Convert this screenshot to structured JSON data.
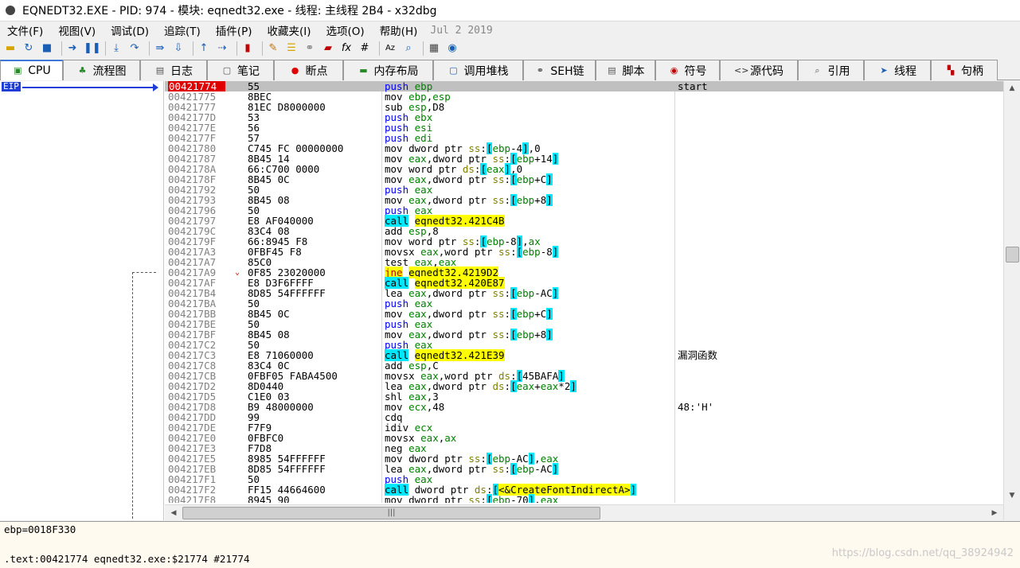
{
  "window": {
    "title": "EQNEDT32.EXE - PID: 974 - 模块: eqnedt32.exe - 线程: 主线程 2B4 - x32dbg"
  },
  "menu": {
    "items": [
      "文件(F)",
      "视图(V)",
      "调试(D)",
      "追踪(T)",
      "插件(P)",
      "收藏夹(I)",
      "选项(O)",
      "帮助(H)"
    ],
    "date": "Jul 2 2019"
  },
  "toolbar": {
    "icons": [
      "open-icon",
      "restart-icon",
      "stop-icon",
      "run-icon",
      "pause-icon",
      "step-into-icon",
      "step-over-icon",
      "run-to-user-icon",
      "execute-till-return-icon",
      "animate-icon",
      "record-icon",
      "patch-icon",
      "comments-icon",
      "labels-icon",
      "bookmarks-icon",
      "functions-icon",
      "fx-icon",
      "hash-icon",
      "strings-icon",
      "search-icon",
      "calculator-icon",
      "cheat-icon"
    ],
    "fx_label": "fx",
    "hash_label": "#",
    "az_label": "Aᴢ"
  },
  "tabs": [
    {
      "label": "CPU",
      "icon": "cpu-icon",
      "active": true
    },
    {
      "label": "流程图",
      "icon": "tree-icon"
    },
    {
      "label": "日志",
      "icon": "log-icon"
    },
    {
      "label": "笔记",
      "icon": "notes-icon"
    },
    {
      "label": "断点",
      "icon": "breakpoint-icon"
    },
    {
      "label": "内存布局",
      "icon": "memory-icon"
    },
    {
      "label": "调用堆栈",
      "icon": "callstack-icon"
    },
    {
      "label": "SEH链",
      "icon": "seh-icon"
    },
    {
      "label": "脚本",
      "icon": "script-icon"
    },
    {
      "label": "符号",
      "icon": "symbol-icon"
    },
    {
      "label": "源代码",
      "icon": "source-icon"
    },
    {
      "label": "引用",
      "icon": "references-icon"
    },
    {
      "label": "线程",
      "icon": "threads-icon"
    },
    {
      "label": "句柄",
      "icon": "handles-icon"
    }
  ],
  "eip_label": "EIP",
  "disasm": [
    {
      "addr": "00421774",
      "bytes": "55",
      "instr": "push ebp",
      "comment": "start",
      "bp": true,
      "selected": true
    },
    {
      "addr": "00421775",
      "bytes": "8BEC",
      "instr": "mov ebp,esp"
    },
    {
      "addr": "00421777",
      "bytes": "81EC D8000000",
      "instr": "sub esp,D8"
    },
    {
      "addr": "0042177D",
      "bytes": "53",
      "instr": "push ebx"
    },
    {
      "addr": "0042177E",
      "bytes": "56",
      "instr": "push esi"
    },
    {
      "addr": "0042177F",
      "bytes": "57",
      "instr": "push edi"
    },
    {
      "addr": "00421780",
      "bytes": "C745 FC 00000000",
      "instr": "mov dword ptr ss:[ebp-4],0"
    },
    {
      "addr": "00421787",
      "bytes": "8B45 14",
      "instr": "mov eax,dword ptr ss:[ebp+14]"
    },
    {
      "addr": "0042178A",
      "bytes": "66:C700 0000",
      "instr": "mov word ptr ds:[eax],0"
    },
    {
      "addr": "0042178F",
      "bytes": "8B45 0C",
      "instr": "mov eax,dword ptr ss:[ebp+C]"
    },
    {
      "addr": "00421792",
      "bytes": "50",
      "instr": "push eax"
    },
    {
      "addr": "00421793",
      "bytes": "8B45 08",
      "instr": "mov eax,dword ptr ss:[ebp+8]"
    },
    {
      "addr": "00421796",
      "bytes": "50",
      "instr": "push eax"
    },
    {
      "addr": "00421797",
      "bytes": "E8 AF040000",
      "instr": "call eqnedt32.421C4B"
    },
    {
      "addr": "0042179C",
      "bytes": "83C4 08",
      "instr": "add esp,8"
    },
    {
      "addr": "0042179F",
      "bytes": "66:8945 F8",
      "instr": "mov word ptr ss:[ebp-8],ax"
    },
    {
      "addr": "004217A3",
      "bytes": "0FBF45 F8",
      "instr": "movsx eax,word ptr ss:[ebp-8]"
    },
    {
      "addr": "004217A7",
      "bytes": "85C0",
      "instr": "test eax,eax"
    },
    {
      "addr": "004217A9",
      "bytes": "0F85 23020000",
      "instr": "jne eqnedt32.4219D2",
      "jmp": "⌄"
    },
    {
      "addr": "004217AF",
      "bytes": "E8 D3F6FFFF",
      "instr": "call eqnedt32.420E87"
    },
    {
      "addr": "004217B4",
      "bytes": "8D85 54FFFFFF",
      "instr": "lea eax,dword ptr ss:[ebp-AC]"
    },
    {
      "addr": "004217BA",
      "bytes": "50",
      "instr": "push eax"
    },
    {
      "addr": "004217BB",
      "bytes": "8B45 0C",
      "instr": "mov eax,dword ptr ss:[ebp+C]"
    },
    {
      "addr": "004217BE",
      "bytes": "50",
      "instr": "push eax"
    },
    {
      "addr": "004217BF",
      "bytes": "8B45 08",
      "instr": "mov eax,dword ptr ss:[ebp+8]"
    },
    {
      "addr": "004217C2",
      "bytes": "50",
      "instr": "push eax"
    },
    {
      "addr": "004217C3",
      "bytes": "E8 71060000",
      "instr": "call eqnedt32.421E39",
      "comment": "漏洞函数"
    },
    {
      "addr": "004217C8",
      "bytes": "83C4 0C",
      "instr": "add esp,C"
    },
    {
      "addr": "004217CB",
      "bytes": "0FBF05 FABA4500",
      "instr": "movsx eax,word ptr ds:[45BAFA]"
    },
    {
      "addr": "004217D2",
      "bytes": "8D0440",
      "instr": "lea eax,dword ptr ds:[eax+eax*2]"
    },
    {
      "addr": "004217D5",
      "bytes": "C1E0 03",
      "instr": "shl eax,3"
    },
    {
      "addr": "004217D8",
      "bytes": "B9 48000000",
      "instr": "mov ecx,48",
      "comment": "48:'H'"
    },
    {
      "addr": "004217DD",
      "bytes": "99",
      "instr": "cdq"
    },
    {
      "addr": "004217DE",
      "bytes": "F7F9",
      "instr": "idiv ecx"
    },
    {
      "addr": "004217E0",
      "bytes": "0FBFC0",
      "instr": "movsx eax,ax"
    },
    {
      "addr": "004217E3",
      "bytes": "F7D8",
      "instr": "neg eax"
    },
    {
      "addr": "004217E5",
      "bytes": "8985 54FFFFFF",
      "instr": "mov dword ptr ss:[ebp-AC],eax"
    },
    {
      "addr": "004217EB",
      "bytes": "8D85 54FFFFFF",
      "instr": "lea eax,dword ptr ss:[ebp-AC]"
    },
    {
      "addr": "004217F1",
      "bytes": "50",
      "instr": "push eax"
    },
    {
      "addr": "004217F2",
      "bytes": "FF15 44664600",
      "instr": "call dword ptr ds:[<&CreateFontIndirectA>]"
    },
    {
      "addr": "004217F8",
      "bytes": "8945 90",
      "instr": "mov dword ptr ss:[ebp-70],eax"
    }
  ],
  "scroll": {
    "hthumb_label": "|||"
  },
  "info": {
    "line1": "ebp=0018F330",
    "line2": ".text:00421774 eqnedt32.exe:$21774 #21774",
    "watermark": "https://blog.csdn.net/qq_38924942"
  }
}
